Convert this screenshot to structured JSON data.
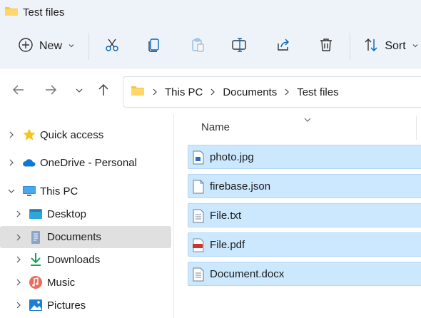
{
  "window": {
    "title": "Test files"
  },
  "toolbar": {
    "new_label": "New",
    "sort_label": "Sort",
    "actions": [
      "cut",
      "copy",
      "paste",
      "rename",
      "share",
      "delete"
    ]
  },
  "address": {
    "breadcrumbs": [
      "This PC",
      "Documents",
      "Test files"
    ]
  },
  "sidebar": {
    "items": [
      {
        "label": "Quick access",
        "icon": "star-icon"
      },
      {
        "label": "OneDrive - Personal",
        "icon": "cloud-icon"
      },
      {
        "label": "This PC",
        "icon": "monitor-icon",
        "expanded": true
      },
      {
        "label": "Desktop",
        "icon": "desktop-folder-icon"
      },
      {
        "label": "Documents",
        "icon": "documents-folder-icon",
        "selected": true
      },
      {
        "label": "Downloads",
        "icon": "download-icon"
      },
      {
        "label": "Music",
        "icon": "music-icon"
      },
      {
        "label": "Pictures",
        "icon": "pictures-icon"
      }
    ]
  },
  "content": {
    "column_header": "Name",
    "files": [
      {
        "name": "photo.jpg",
        "icon": "image-file-icon"
      },
      {
        "name": "firebase.json",
        "icon": "json-file-icon"
      },
      {
        "name": "File.txt",
        "icon": "text-file-icon"
      },
      {
        "name": "File.pdf",
        "icon": "pdf-file-icon"
      },
      {
        "name": "Document.docx",
        "icon": "docx-file-icon"
      }
    ]
  },
  "colors": {
    "accent": "#0067c0",
    "selection": "#cce8ff",
    "folder": "#f6c64a",
    "toolbar_bg": "#eef3f9"
  }
}
